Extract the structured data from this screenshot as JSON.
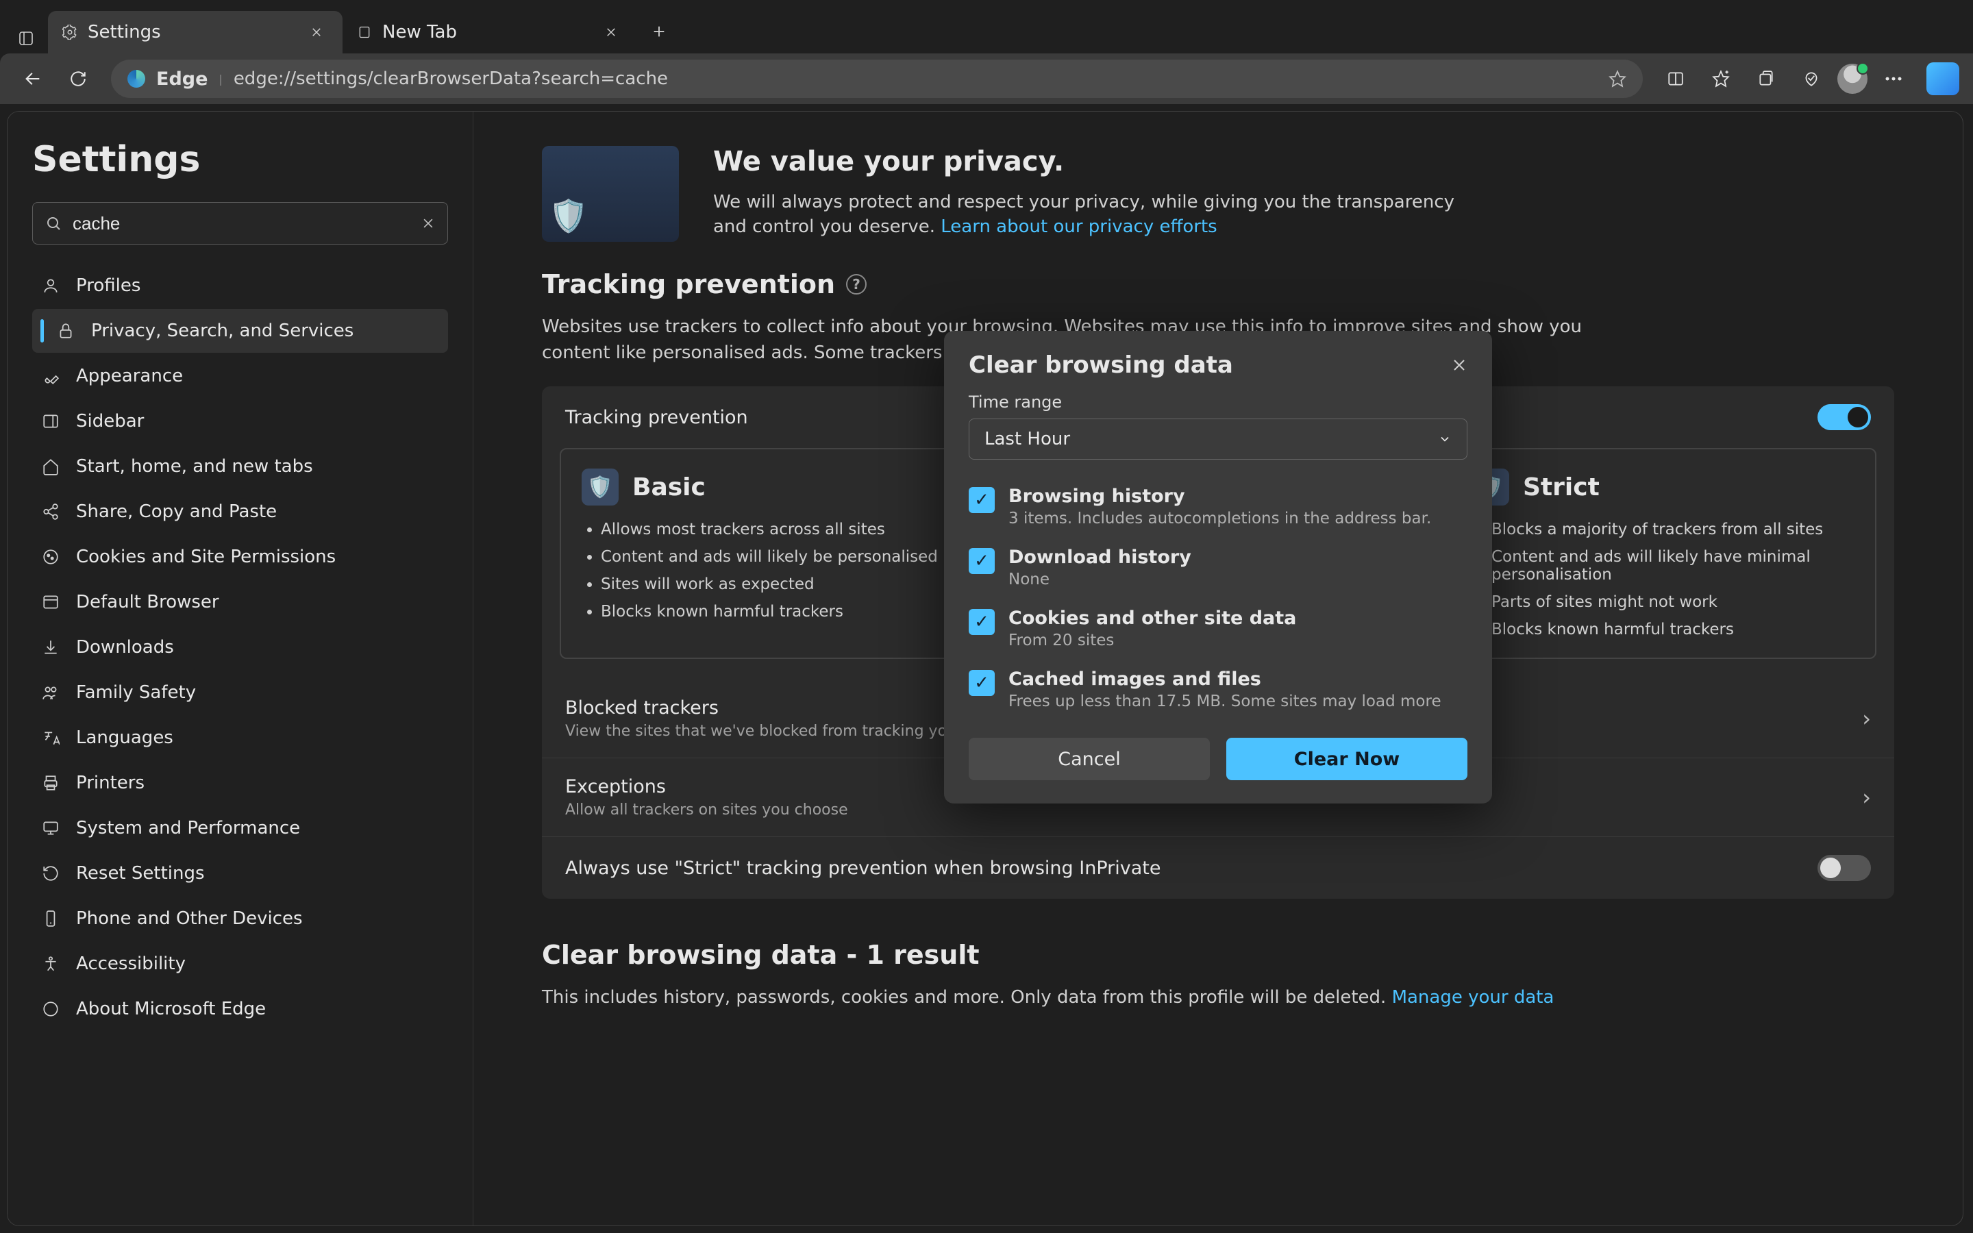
{
  "chrome": {
    "tabs": [
      {
        "label": "Settings",
        "active": true
      },
      {
        "label": "New Tab",
        "active": false
      }
    ],
    "edge_label": "Edge",
    "url": "edge://settings/clearBrowserData?search=cache"
  },
  "sidebar": {
    "title": "Settings",
    "search_value": "cache",
    "items": [
      {
        "icon": "person",
        "label": "Profiles"
      },
      {
        "icon": "lock",
        "label": "Privacy, Search, and Services",
        "active": true
      },
      {
        "icon": "brush",
        "label": "Appearance"
      },
      {
        "icon": "panel",
        "label": "Sidebar"
      },
      {
        "icon": "home",
        "label": "Start, home, and new tabs"
      },
      {
        "icon": "share",
        "label": "Share, Copy and Paste"
      },
      {
        "icon": "cookie",
        "label": "Cookies and Site Permissions"
      },
      {
        "icon": "browser",
        "label": "Default Browser"
      },
      {
        "icon": "download",
        "label": "Downloads"
      },
      {
        "icon": "family",
        "label": "Family Safety"
      },
      {
        "icon": "lang",
        "label": "Languages"
      },
      {
        "icon": "printer",
        "label": "Printers"
      },
      {
        "icon": "system",
        "label": "System and Performance"
      },
      {
        "icon": "reset",
        "label": "Reset Settings"
      },
      {
        "icon": "phone",
        "label": "Phone and Other Devices"
      },
      {
        "icon": "access",
        "label": "Accessibility"
      },
      {
        "icon": "edge",
        "label": "About Microsoft Edge"
      }
    ]
  },
  "hero": {
    "heading": "We value your privacy.",
    "body": "We will always protect and respect your privacy, while giving you the transparency and control you deserve. ",
    "link": "Learn about our privacy efforts"
  },
  "tracking": {
    "title": "Tracking prevention",
    "desc": "Websites use trackers to collect info about your browsing. Websites may use this info to improve sites and show you content like personalised ads. Some trackers collect and send your info to sites you haven't visited.",
    "toggle_label": "Tracking prevention",
    "modes": {
      "basic": {
        "name": "Basic",
        "bullets": [
          "Allows most trackers across all sites",
          "Content and ads will likely be personalised",
          "Sites will work as expected",
          "Blocks known harmful trackers"
        ]
      },
      "strict": {
        "name": "Strict",
        "bullets": [
          "Blocks a majority of trackers from all sites",
          "Content and ads will likely have minimal personalisation",
          "Parts of sites might not work",
          "Blocks known harmful trackers"
        ]
      }
    },
    "blocked": {
      "title": "Blocked trackers",
      "sub": "View the sites that we've blocked from tracking you"
    },
    "exceptions": {
      "title": "Exceptions",
      "sub": "Allow all trackers on sites you choose"
    },
    "strict_inprivate": "Always use \"Strict\" tracking prevention when browsing InPrivate"
  },
  "clear_section": {
    "title": "Clear browsing data - 1 result",
    "desc": "This includes history, passwords, cookies and more. Only data from this profile will be deleted. ",
    "link": "Manage your data"
  },
  "dialog": {
    "title": "Clear browsing data",
    "time_label": "Time range",
    "time_value": "Last Hour",
    "items": [
      {
        "checked": true,
        "title": "Browsing history",
        "sub": "3 items. Includes autocompletions in the address bar."
      },
      {
        "checked": true,
        "title": "Download history",
        "sub": "None"
      },
      {
        "checked": true,
        "title": "Cookies and other site data",
        "sub": "From 20 sites"
      },
      {
        "checked": true,
        "title": "Cached images and files",
        "sub": "Frees up less than 17.5 MB. Some sites may load more"
      }
    ],
    "cancel": "Cancel",
    "clear": "Clear Now"
  }
}
